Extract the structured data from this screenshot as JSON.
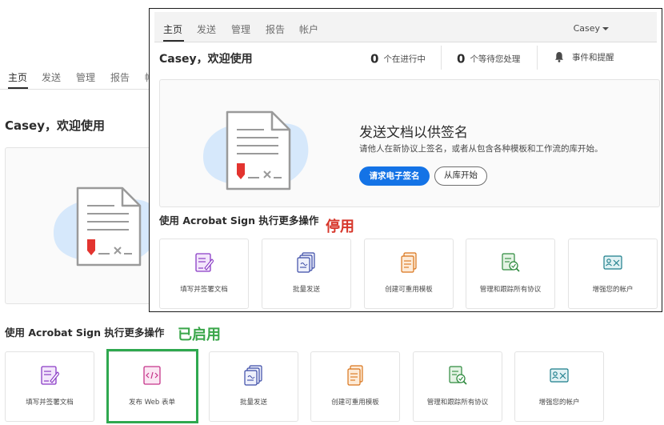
{
  "background_screen": {
    "nav": {
      "items": [
        {
          "label": "主页"
        },
        {
          "label": "发送"
        },
        {
          "label": "管理"
        },
        {
          "label": "报告"
        },
        {
          "label": "帐"
        }
      ]
    },
    "welcome": "Casey，欢迎使用",
    "more_title": "使用 Acrobat Sign 执行更多操作",
    "status_label": "已启用",
    "cards": [
      {
        "label": "填写并签署文档",
        "icon": "fill-sign-icon"
      },
      {
        "label": "发布 Web 表单",
        "icon": "web-form-icon"
      },
      {
        "label": "批量发送",
        "icon": "bulk-send-icon"
      },
      {
        "label": "创建可重用模板",
        "icon": "template-icon"
      },
      {
        "label": "管理和跟踪所有协议",
        "icon": "manage-track-icon"
      },
      {
        "label": "增强您的帐户",
        "icon": "account-icon"
      }
    ],
    "highlight_color": "#2fa84f"
  },
  "foreground_screen": {
    "nav": {
      "items": [
        {
          "label": "主页"
        },
        {
          "label": "发送"
        },
        {
          "label": "管理"
        },
        {
          "label": "报告"
        },
        {
          "label": "帐户"
        }
      ],
      "user": "Casey"
    },
    "welcome": "Casey，欢迎使用",
    "stats": [
      {
        "value": "0",
        "label": "个在进行中"
      },
      {
        "value": "0",
        "label": "个等待您处理"
      }
    ],
    "events_label": "事件和提醒",
    "hero": {
      "title": "发送文档以供签名",
      "subtitle": "请他人在新协议上签名，或者从包含各种模板和工作流的库开始。",
      "primary_button": "请求电子签名",
      "secondary_button": "从库开始"
    },
    "more_title": "使用 Acrobat Sign 执行更多操作",
    "status_label": "停用",
    "cards": [
      {
        "label": "填写并签署文档",
        "icon": "fill-sign-icon"
      },
      {
        "label": "批量发送",
        "icon": "bulk-send-icon"
      },
      {
        "label": "创建可重用模板",
        "icon": "template-icon"
      },
      {
        "label": "管理和跟踪所有协议",
        "icon": "manage-track-icon"
      },
      {
        "label": "增强您的帐户",
        "icon": "account-icon"
      }
    ]
  },
  "colors": {
    "accent_blue": "#1473e6",
    "enabled_green": "#3aa64a",
    "disabled_red": "#d7372b"
  }
}
